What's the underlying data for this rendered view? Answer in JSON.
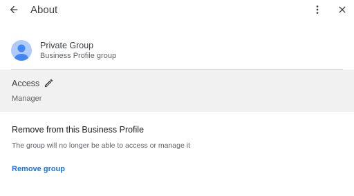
{
  "header": {
    "title": "About",
    "back_icon": "arrow-back-icon",
    "more_icon": "more-vert-icon",
    "close_icon": "close-icon"
  },
  "group": {
    "name": "Private Group",
    "subtitle": "Business Profile group",
    "avatar_icon": "person-avatar-icon",
    "avatar_color": "#aecbfa",
    "avatar_figure_color": "#4285f4"
  },
  "access": {
    "label": "Access",
    "value": "Manager",
    "edit_icon": "pencil-icon",
    "panel_color": "#f1f1f1"
  },
  "remove": {
    "title": "Remove from this Business Profile",
    "description": "The group will no longer be able to access or manage it",
    "link_label": "Remove group",
    "link_color": "#1a73e8"
  }
}
